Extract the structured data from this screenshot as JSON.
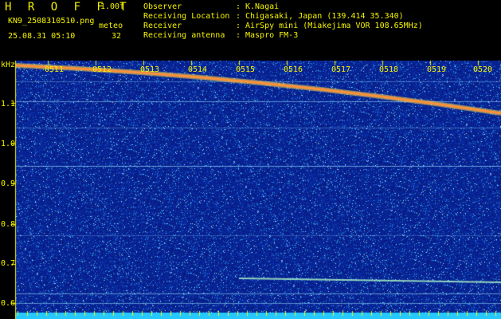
{
  "header": {
    "brand": "H R O F F T",
    "version": "1.00f",
    "filename": "KN9_2508310510.png",
    "timestamp": "25.08.31 05:10",
    "meteor_label": "meteo",
    "meteor_count": "32"
  },
  "meta": [
    {
      "label": "Observer",
      "sep": ":",
      "value": "K.Nagai"
    },
    {
      "label": "Receiving Location",
      "sep": ":",
      "value": "Chigasaki, Japan (139.414 35.340)"
    },
    {
      "label": "Receiver",
      "sep": ":",
      "value": "AirSpy mini (Miakejima VOR 108.65MHz)"
    },
    {
      "label": "Receiving antenna",
      "sep": ":",
      "value": "Maspro FM-3"
    }
  ],
  "y_axis": {
    "unit": "kHz",
    "ticks": [
      "1.1",
      "1.0",
      "0.9",
      "0.8",
      "0.7",
      "0.6"
    ]
  },
  "time_axis": {
    "ticks": [
      "0511",
      "0512",
      "0513",
      "0514",
      "0515",
      "0516",
      "0517",
      "0518",
      "0519",
      "0520"
    ]
  },
  "colors": {
    "background": "#000000",
    "text": "#f6f400",
    "noise_base": "#0a1f8c",
    "trace": "#ff2a1a",
    "line": "#7ad8ff"
  }
}
